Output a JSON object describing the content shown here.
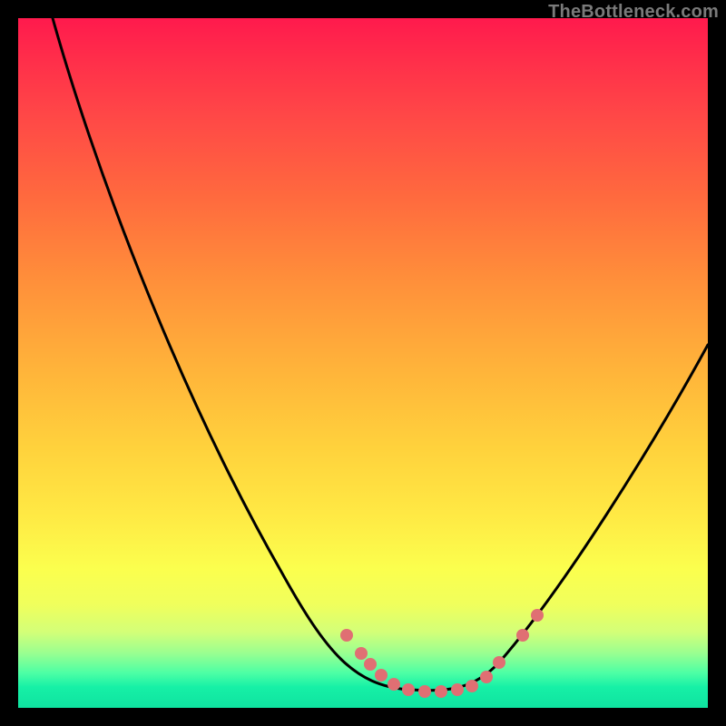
{
  "watermark": "TheBottleneck.com",
  "colors": {
    "background": "#000000",
    "curve": "#000000",
    "dots": "#e06f73",
    "gradient_top": "#ff1a4d",
    "gradient_bottom": "#0fe3a0"
  },
  "chart_data": {
    "type": "line",
    "title": "",
    "xlabel": "",
    "ylabel": "",
    "xlim": [
      0,
      100
    ],
    "ylim": [
      0,
      100
    ],
    "grid": false,
    "legend": false,
    "curve_note": "Asymmetric V-shaped bottleneck curve; y≈0 is the valley. Values estimated from pixel position (no axis ticks are shown).",
    "series": [
      {
        "name": "bottleneck-curve",
        "x": [
          5,
          10,
          15,
          20,
          25,
          30,
          35,
          40,
          45,
          50,
          55,
          58,
          60,
          62,
          65,
          68,
          72,
          76,
          80,
          85,
          90,
          95,
          100
        ],
        "y": [
          100,
          88,
          76,
          64,
          52,
          41,
          31,
          22,
          14,
          8,
          3,
          1,
          0.5,
          0.5,
          0.5,
          1,
          3,
          8,
          15,
          24,
          34,
          44,
          54
        ]
      },
      {
        "name": "highlight-dots",
        "x": [
          50,
          52,
          54,
          55,
          57,
          59,
          61,
          63,
          65,
          67,
          69,
          71,
          74,
          76
        ],
        "y": [
          8,
          6,
          4,
          3,
          2,
          1,
          1,
          1,
          1,
          1,
          2,
          4,
          8,
          12
        ]
      }
    ]
  }
}
